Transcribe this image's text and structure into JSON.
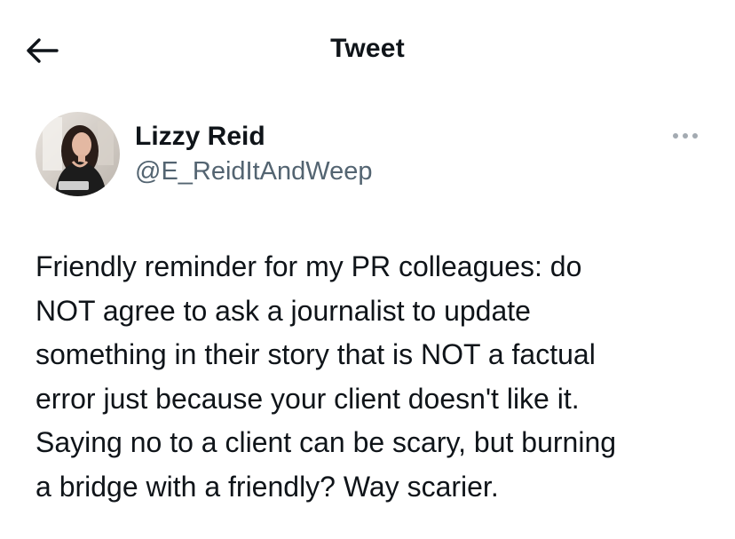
{
  "header": {
    "title": "Tweet",
    "back_icon": "arrow-left-icon"
  },
  "author": {
    "display_name": "Lizzy Reid",
    "handle": "@E_ReidItAndWeep",
    "more_icon": "more-horizontal-icon"
  },
  "tweet": {
    "lines": [
      "Friendly reminder for my PR colleagues: do",
      "NOT agree to ask a journalist to update",
      "something in their story that is NOT a factual",
      "error just because your client doesn't like it.",
      "Saying no to a client can be scary, but burning",
      "a bridge with a friendly? Way scarier."
    ]
  },
  "colors": {
    "text": "#0f1419",
    "secondary": "#536471",
    "icon_muted": "#a3aab1"
  }
}
